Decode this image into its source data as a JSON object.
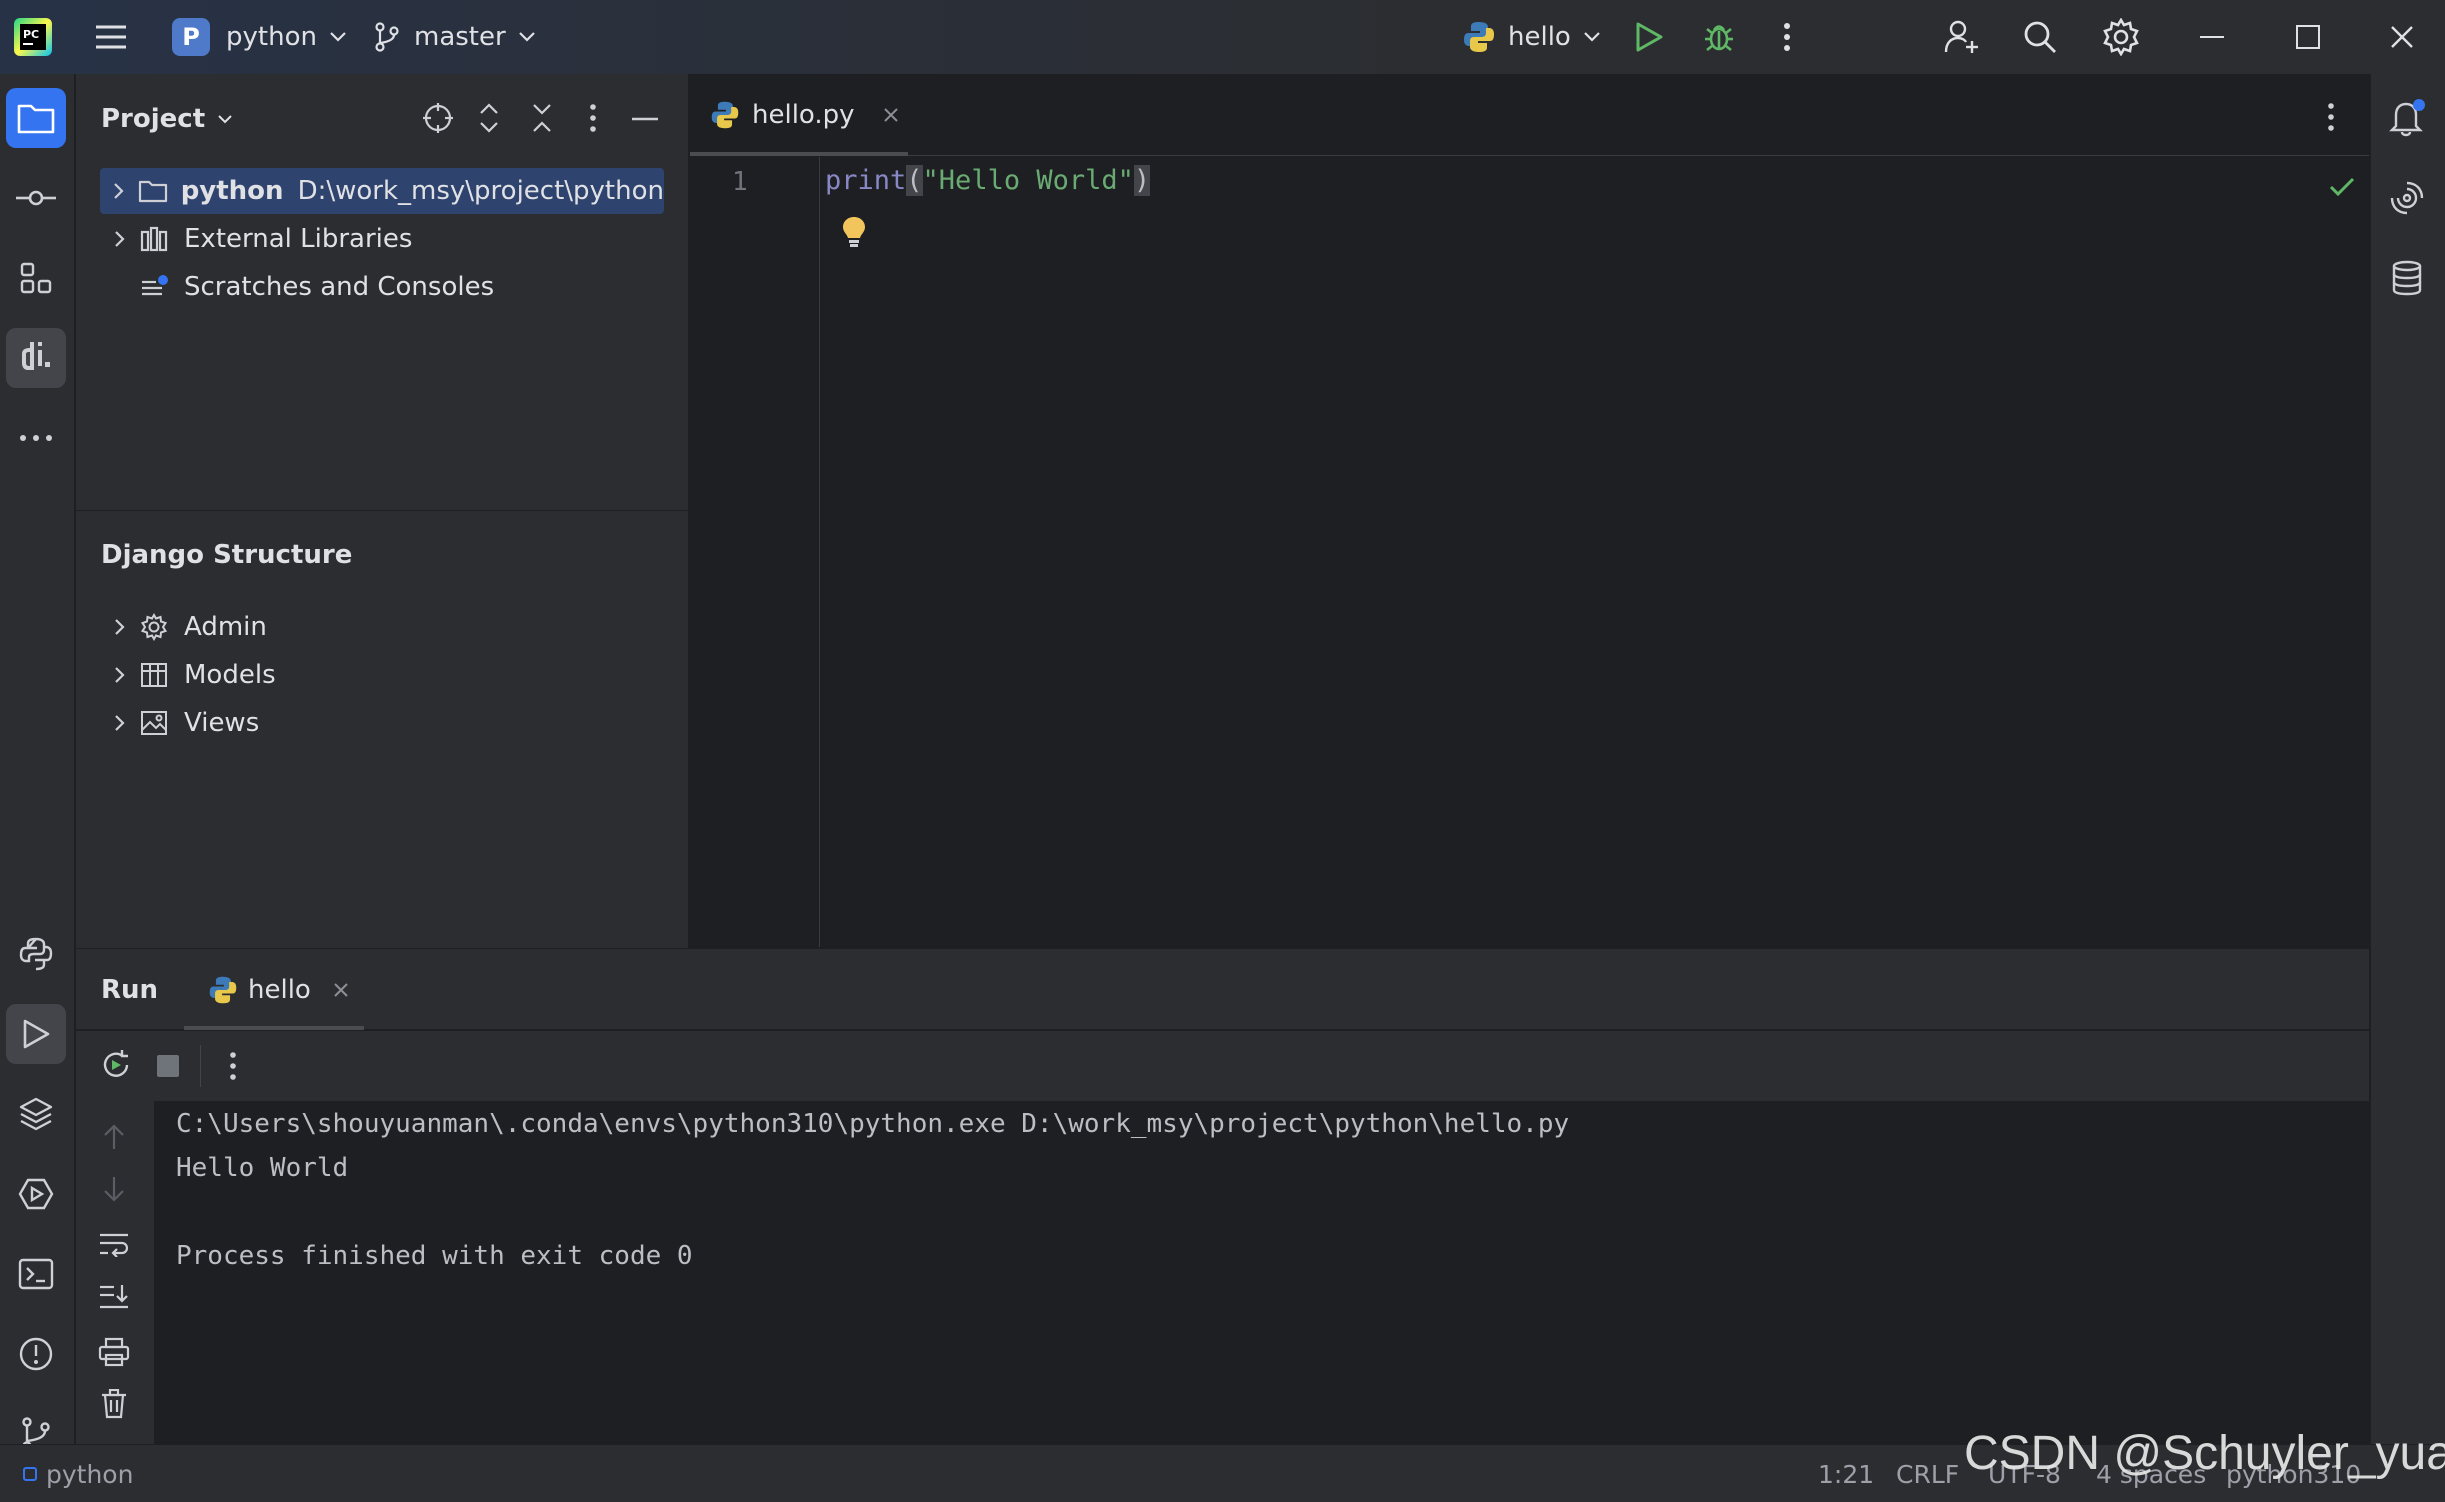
{
  "titlebar": {
    "project_badge": "P",
    "project_name": "python",
    "branch": "master",
    "run_config": "hello"
  },
  "project_panel": {
    "title": "Project",
    "tree": [
      {
        "label": "python",
        "path": "D:\\work_msy\\project\\python"
      },
      {
        "label": "External Libraries"
      },
      {
        "label": "Scratches and Consoles"
      }
    ]
  },
  "django_panel": {
    "title": "Django Structure",
    "items": [
      {
        "label": "Admin"
      },
      {
        "label": "Models"
      },
      {
        "label": "Views"
      }
    ]
  },
  "editor": {
    "tab_label": "hello.py",
    "line_number": "1",
    "code": {
      "fn": "print",
      "open": "(",
      "str": "\"Hello World\"",
      "close": ")"
    }
  },
  "run_panel": {
    "title": "Run",
    "tab_label": "hello",
    "console": [
      "C:\\Users\\shouyuanman\\.conda\\envs\\python310\\python.exe D:\\work_msy\\project\\python\\hello.py",
      "Hello World",
      "",
      "Process finished with exit code 0"
    ]
  },
  "statusbar": {
    "project": "python",
    "position": "1:21",
    "line_sep": "CRLF",
    "encoding": "UTF-8",
    "indent": "4 spaces",
    "interpreter": "python310"
  },
  "watermark": "CSDN @Schuyler_yuan",
  "colors": {
    "accent": "#3574f0",
    "run_green": "#5fb865",
    "selection": "#2e436e",
    "background": "#1e1f22",
    "panel": "#2b2d30"
  }
}
